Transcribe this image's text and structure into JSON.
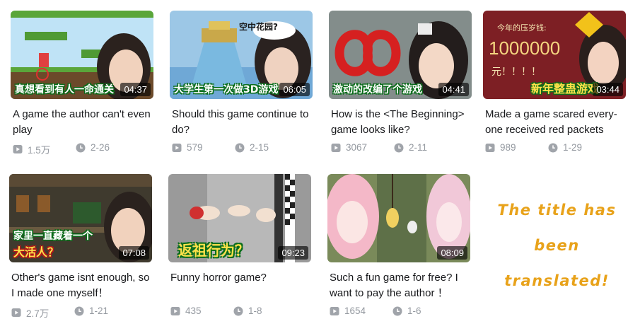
{
  "colors": {
    "accent_note": "#e8a21a",
    "stat_gray": "#9499a0",
    "duration_bg": "rgba(0,0,0,0.62)"
  },
  "icons": {
    "views": "play-count-icon",
    "date": "clock-icon"
  },
  "videos": [
    {
      "duration": "04:37",
      "caption": "真想看到有人一命通关",
      "title": "A game the author can't even play",
      "views": "1.5万",
      "date": "2-26"
    },
    {
      "duration": "06:05",
      "caption": "大学生第一次做3D游戏",
      "sub_caption": "空中花园?",
      "title": "Should this game continue to do?",
      "views": "579",
      "date": "2-15"
    },
    {
      "duration": "04:41",
      "caption": "激动的改编了个游戏",
      "title": "How is the <The Beginning> game looks like?",
      "views": "3067",
      "date": "2-11"
    },
    {
      "duration": "03:44",
      "caption": "新年整蛊游戏",
      "overlay_top": "今年的压岁钱:",
      "overlay_amount": "1000000",
      "overlay_bottom": "元！！！！",
      "title": "Made a game  scared every-one received red packets",
      "views": "989",
      "date": "1-29"
    },
    {
      "duration": "07:08",
      "caption": "家里一直藏着一个",
      "caption2": "大活人？",
      "title": "Other's game isnt enough, so I made one myself！",
      "views": "2.7万",
      "date": "1-21"
    },
    {
      "duration": "09:23",
      "caption": "返祖行为？",
      "title": "Funny horror game?",
      "views": "435",
      "date": "1-8"
    },
    {
      "duration": "08:09",
      "title": "Such a fun game for free? I want to pay the author ！",
      "views": "1654",
      "date": "1-6"
    }
  ],
  "note": {
    "line1": "The title has",
    "line2": "been",
    "line3": "translated!"
  }
}
